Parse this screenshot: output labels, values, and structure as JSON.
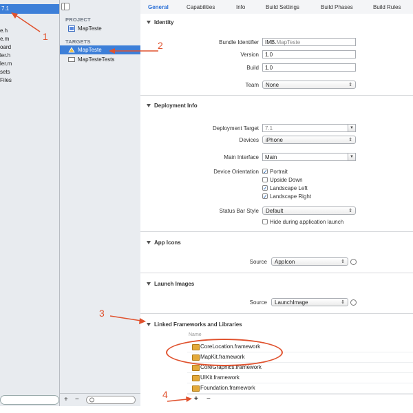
{
  "navigator": {
    "selected_item": "7.1",
    "files": [
      "e.h",
      "e.m",
      "oard",
      "ler.h",
      "ler.m",
      "sets",
      "Files"
    ]
  },
  "targets_panel": {
    "project_header": "PROJECT",
    "project_name": "MapTeste",
    "targets_header": "TARGETS",
    "targets": [
      "MapTeste",
      "MapTesteTests"
    ],
    "bottom_add": "+",
    "bottom_remove": "−"
  },
  "tabs": [
    "General",
    "Capabilities",
    "Info",
    "Build Settings",
    "Build Phases",
    "Build Rules"
  ],
  "identity": {
    "title": "Identity",
    "bundle_identifier_label": "Bundle Identifier",
    "bundle_identifier_prefix": "IMB.",
    "bundle_identifier_value": "MapTeste",
    "version_label": "Version",
    "version_value": "1.0",
    "build_label": "Build",
    "build_value": "1.0",
    "team_label": "Team",
    "team_value": "None"
  },
  "deployment": {
    "title": "Deployment Info",
    "target_label": "Deployment Target",
    "target_value": "7.1",
    "devices_label": "Devices",
    "devices_value": "iPhone",
    "main_interface_label": "Main Interface",
    "main_interface_value": "Main",
    "orientation_label": "Device Orientation",
    "orientations": [
      {
        "label": "Portrait",
        "checked": true
      },
      {
        "label": "Upside Down",
        "checked": false
      },
      {
        "label": "Landscape Left",
        "checked": true
      },
      {
        "label": "Landscape Right",
        "checked": true
      }
    ],
    "status_bar_label": "Status Bar Style",
    "status_bar_value": "Default",
    "hide_status_label": "Hide during application launch"
  },
  "app_icons": {
    "title": "App Icons",
    "source_label": "Source",
    "source_value": "AppIcon"
  },
  "launch_images": {
    "title": "Launch Images",
    "source_label": "Source",
    "source_value": "LaunchImage"
  },
  "frameworks": {
    "title": "Linked Frameworks and Libraries",
    "column_header": "Name",
    "items": [
      "CoreLocation.framework",
      "MapKit.framework",
      "CoreGraphics.framework",
      "UIKit.framework",
      "Foundation.framework"
    ],
    "add": "+",
    "remove": "−"
  },
  "annotations": [
    "1",
    "2",
    "3",
    "4"
  ],
  "colors": {
    "accent": "#3d7fd8",
    "annotation": "#e0522e"
  }
}
